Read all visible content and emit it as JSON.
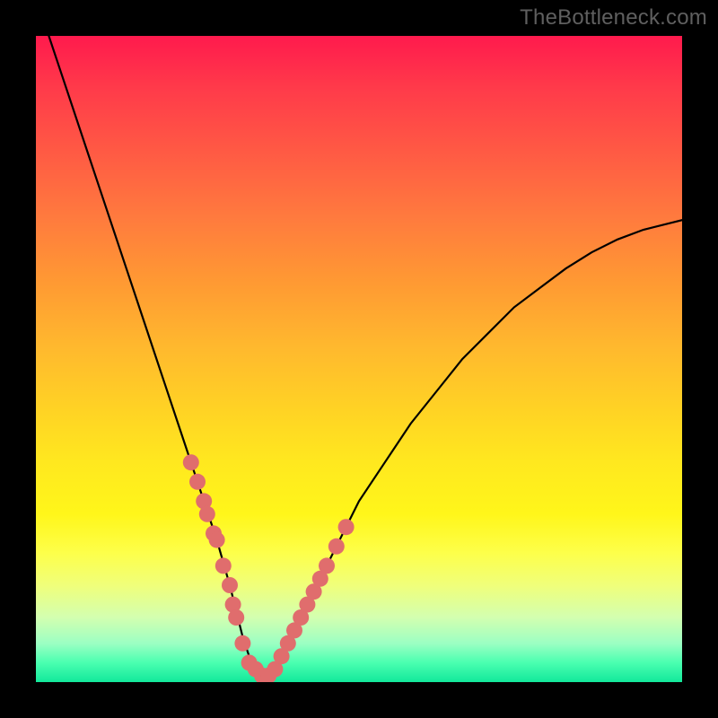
{
  "watermark": "TheBottleneck.com",
  "colors": {
    "curve": "#000000",
    "dot_fill": "#e06d6d",
    "dot_stroke": "#d85a5a",
    "background_black": "#000000"
  },
  "chart_data": {
    "type": "line",
    "title": "",
    "subtitle": "",
    "xlabel": "",
    "ylabel": "",
    "xlim": [
      0,
      100
    ],
    "ylim": [
      0,
      100
    ],
    "grid": false,
    "legend": false,
    "series": [
      {
        "name": "bottleneck-curve",
        "x": [
          2,
          4,
          6,
          8,
          10,
          12,
          14,
          16,
          18,
          20,
          22,
          24,
          26,
          28,
          30,
          31,
          32,
          33,
          34,
          35,
          36,
          37,
          38,
          40,
          42,
          44,
          46,
          48,
          50,
          54,
          58,
          62,
          66,
          70,
          74,
          78,
          82,
          86,
          90,
          94,
          98,
          100
        ],
        "y": [
          100,
          94,
          88,
          82,
          76,
          70,
          64,
          58,
          52,
          46,
          40,
          34,
          28,
          22,
          15,
          11,
          7,
          4,
          2,
          1,
          1,
          2,
          4,
          8,
          12,
          16,
          20,
          24,
          28,
          34,
          40,
          45,
          50,
          54,
          58,
          61,
          64,
          66.5,
          68.5,
          70,
          71,
          71.5
        ]
      }
    ],
    "dots": {
      "name": "highlighted-points",
      "points": [
        {
          "x": 24,
          "y": 34
        },
        {
          "x": 25,
          "y": 31
        },
        {
          "x": 26,
          "y": 28
        },
        {
          "x": 26.5,
          "y": 26
        },
        {
          "x": 27.5,
          "y": 23
        },
        {
          "x": 28,
          "y": 22
        },
        {
          "x": 29,
          "y": 18
        },
        {
          "x": 30,
          "y": 15
        },
        {
          "x": 30.5,
          "y": 12
        },
        {
          "x": 31,
          "y": 10
        },
        {
          "x": 32,
          "y": 6
        },
        {
          "x": 33,
          "y": 3
        },
        {
          "x": 34,
          "y": 2
        },
        {
          "x": 35,
          "y": 1
        },
        {
          "x": 36,
          "y": 1
        },
        {
          "x": 37,
          "y": 2
        },
        {
          "x": 38,
          "y": 4
        },
        {
          "x": 39,
          "y": 6
        },
        {
          "x": 40,
          "y": 8
        },
        {
          "x": 41,
          "y": 10
        },
        {
          "x": 42,
          "y": 12
        },
        {
          "x": 43,
          "y": 14
        },
        {
          "x": 44,
          "y": 16
        },
        {
          "x": 45,
          "y": 18
        },
        {
          "x": 46.5,
          "y": 21
        },
        {
          "x": 48,
          "y": 24
        }
      ]
    }
  }
}
